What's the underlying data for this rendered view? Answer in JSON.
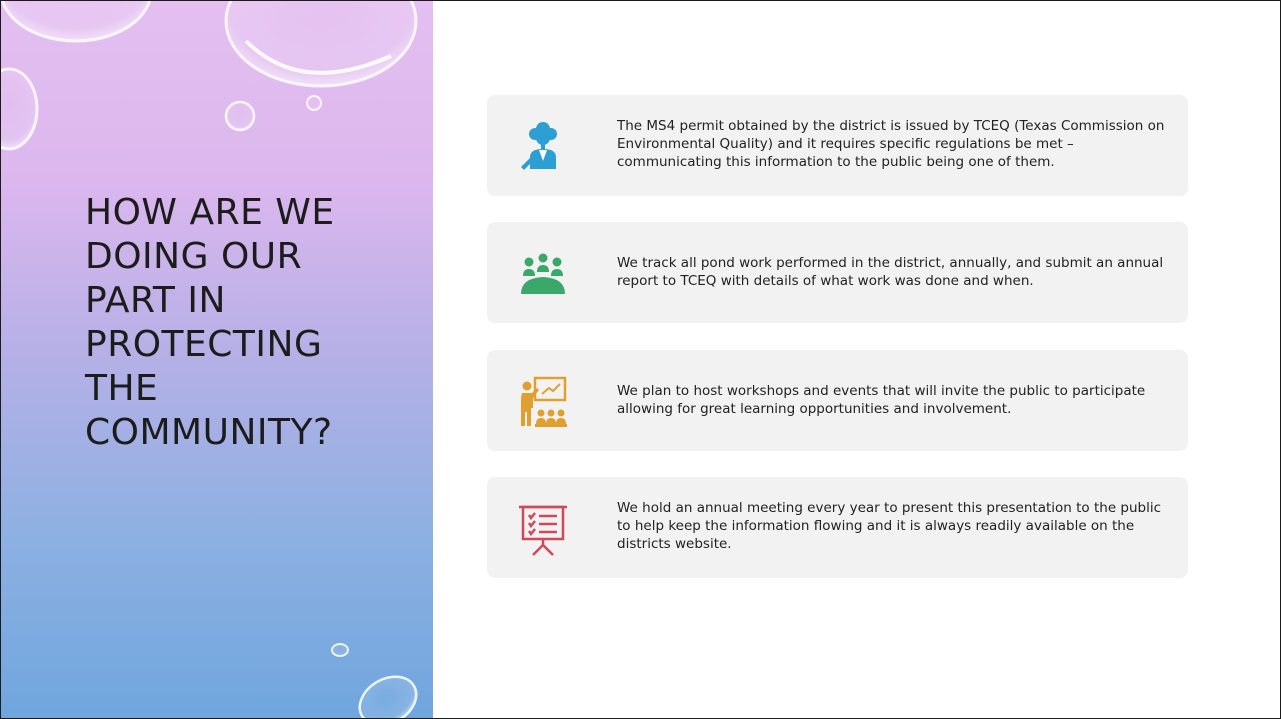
{
  "slide": {
    "title_lines": [
      "HOW ARE WE",
      "DOING OUR",
      "PART IN",
      "PROTECTING",
      "THE",
      "COMMUNITY?"
    ]
  },
  "cards": [
    {
      "icon": "tree-presenter-icon",
      "icon_color": "#2e9fd3",
      "text": "The MS4 permit obtained by the district is issued by TCEQ (Texas Commission on Environmental Quality) and it requires specific regulations be met – communicating this information to the public being one of them."
    },
    {
      "icon": "meeting-group-icon",
      "icon_color": "#3aa86b",
      "text": "We track all pond work performed in the district, annually, and submit an annual report to TCEQ with details of what work was done and when."
    },
    {
      "icon": "classroom-presenter-icon",
      "icon_color": "#e0a030",
      "text": "We plan to host workshops and events that will invite the public to participate allowing for great learning opportunities and involvement."
    },
    {
      "icon": "presentation-board-icon",
      "icon_color": "#cc4a5a",
      "text": "We hold an annual meeting every year to present this presentation to the public to help keep the information flowing and it is always readily available on the districts website."
    }
  ]
}
